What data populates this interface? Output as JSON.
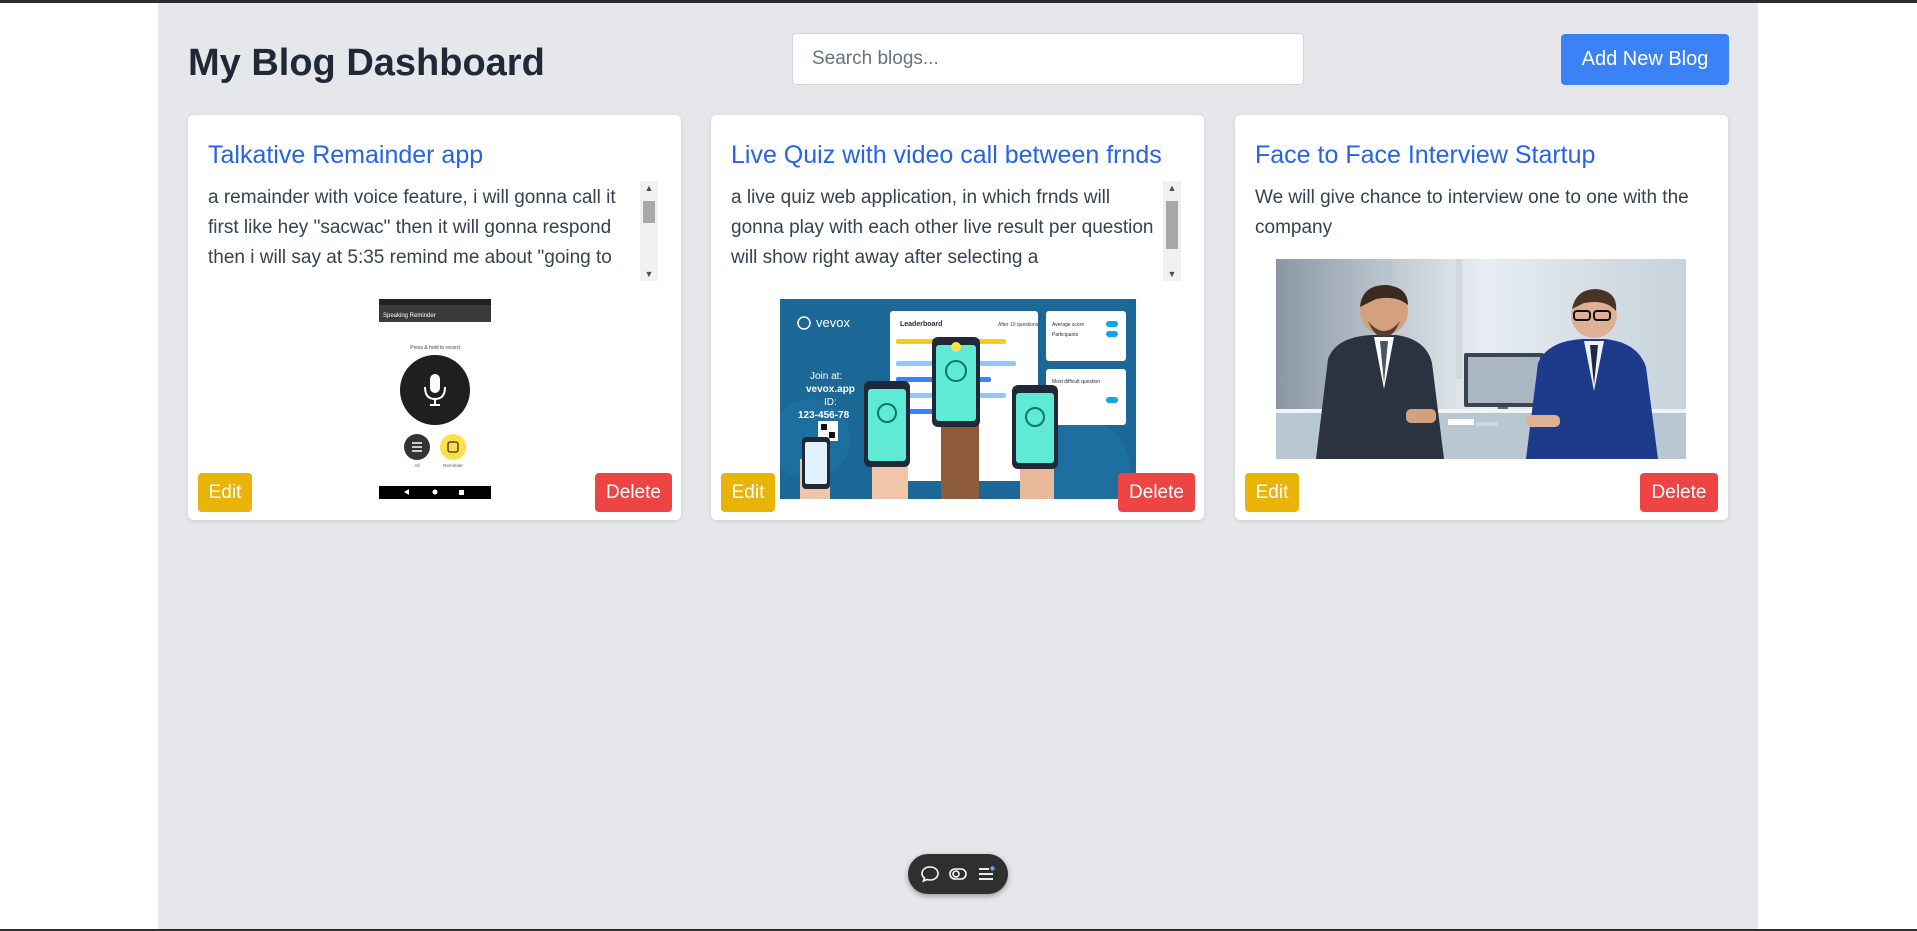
{
  "header": {
    "title": "My Blog Dashboard",
    "search_placeholder": "Search blogs...",
    "search_value": "",
    "add_button": "Add New Blog"
  },
  "blogs": [
    {
      "title": "Talkative Remainder app",
      "description": "a remainder with voice feature, i will gonna call it first like hey \"sacwac\" then it will gonna respond then i will say at 5:35 remind me about \"going to",
      "image": "voice-recorder-app-screenshot",
      "image_text": {
        "app_bar": "Speaking Reminder",
        "hint": "Press & hold to record",
        "label_list": "All",
        "label_reminder": "Reminder"
      },
      "edit": "Edit",
      "delete": "Delete"
    },
    {
      "title": "Live Quiz with video call between frnds",
      "description": "a live quiz web application, in which frnds will gonna play with each other live result per question will show right away after selecting a",
      "image": "live-quiz-leaderboard-illustration",
      "image_text": {
        "brand": "vevox",
        "join_label": "Join at:",
        "join_url": "vevox.app",
        "id_label": "ID:",
        "id_value": "123-456-78",
        "panel_title": "Leaderboard",
        "panel_sub": "After 10 questions",
        "stat_1": "Average score",
        "stat_2": "Participants",
        "card_title": "Most difficult question"
      },
      "edit": "Edit",
      "delete": "Delete"
    },
    {
      "title": "Face to Face Interview Startup",
      "description": "We will give chance to interview one to one with the company",
      "image": "business-interview-photo",
      "edit": "Edit",
      "delete": "Delete"
    }
  ],
  "colors": {
    "background": "#e5e7eb",
    "title_blue": "#2563eb",
    "primary_button": "#3b82f6",
    "edit_button": "#eab308",
    "delete_button": "#ef4444"
  },
  "toolbar": {
    "icons": [
      "chat-icon",
      "toggle-icon",
      "menu-list-icon"
    ]
  }
}
